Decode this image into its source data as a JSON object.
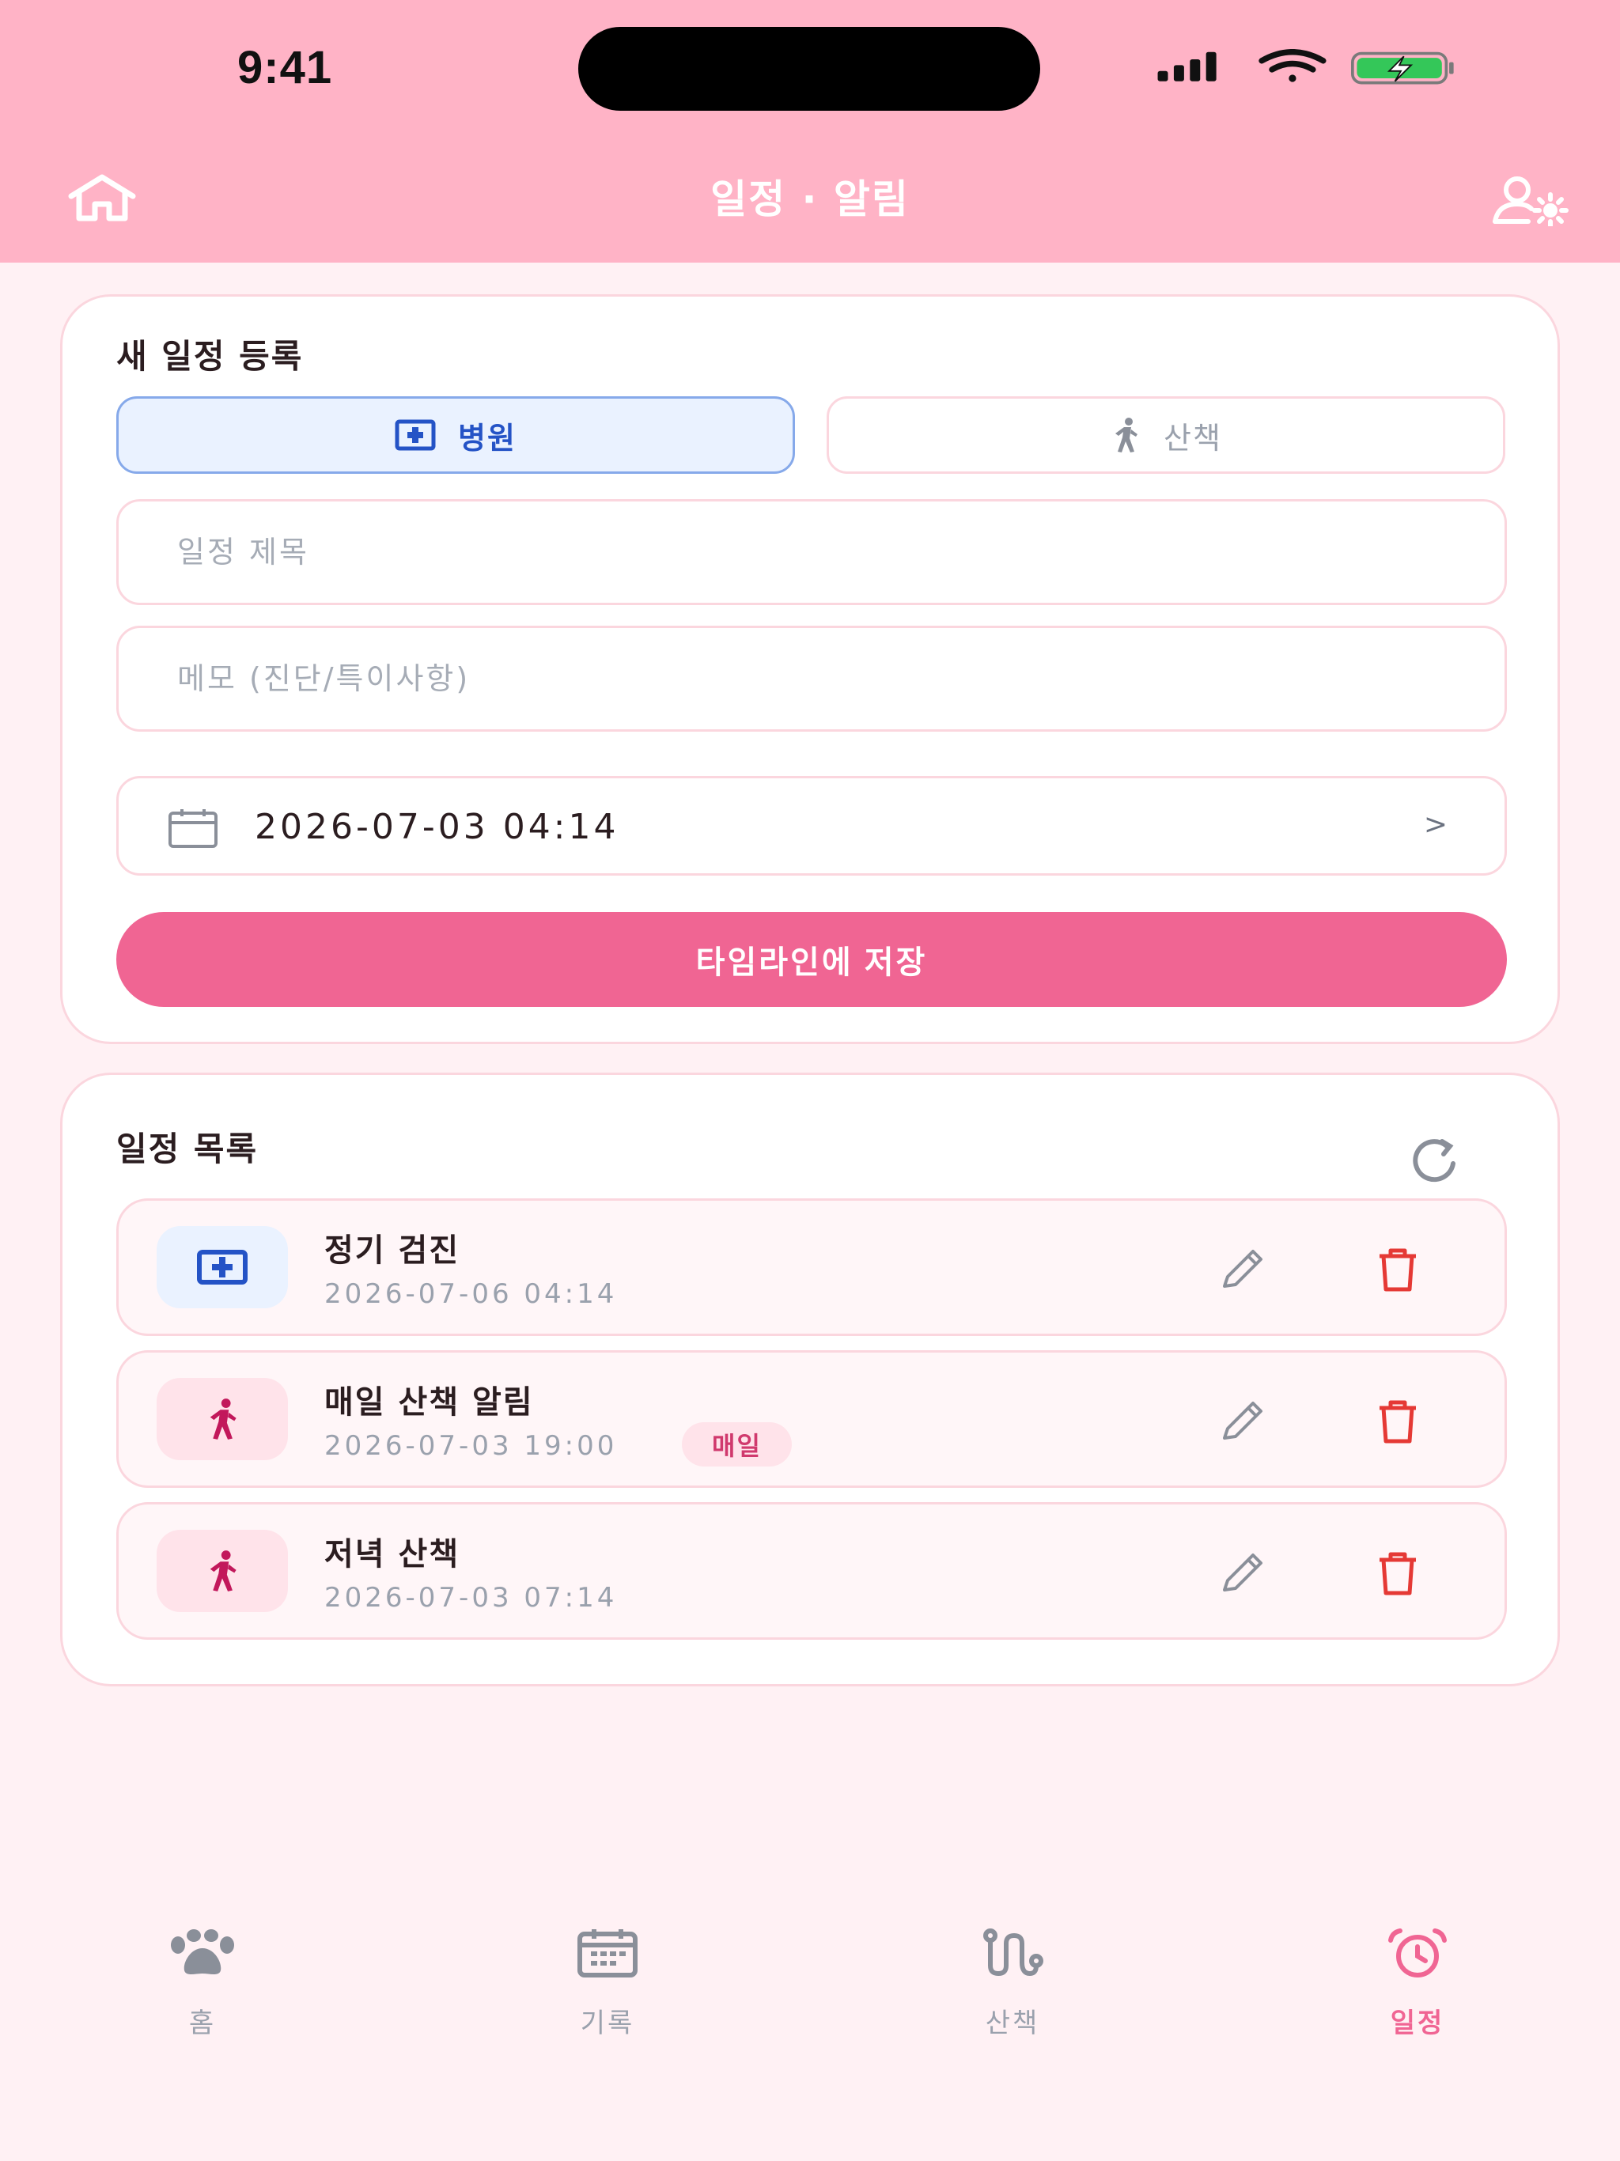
{
  "status_bar": {
    "time": "9:41"
  },
  "header": {
    "title": "일정 · 알림"
  },
  "new_schedule": {
    "title": "새 일정 등록",
    "types": [
      {
        "label": "병원",
        "icon": "hospital-icon",
        "selected": true
      },
      {
        "label": "산책",
        "icon": "walk-icon",
        "selected": false
      }
    ],
    "title_placeholder": "일정 제목",
    "memo_placeholder": "메모 (진단/특이사항)",
    "datetime": "2026-07-03 04:14",
    "chevron": ">",
    "save_label": "타임라인에 저장"
  },
  "schedule_list": {
    "title": "일정 목록",
    "items": [
      {
        "type": "hospital",
        "title": "정기 검진",
        "datetime": "2026-07-06 04:14",
        "badge": ""
      },
      {
        "type": "walk",
        "title": "매일 산책 알림",
        "datetime": "2026-07-03 19:00",
        "badge": "매일"
      },
      {
        "type": "walk",
        "title": "저녁 산책",
        "datetime": "2026-07-03 07:14",
        "badge": ""
      }
    ]
  },
  "tabs": [
    {
      "label": "홈",
      "icon": "paw-icon",
      "active": false
    },
    {
      "label": "기록",
      "icon": "calendar-icon",
      "active": false
    },
    {
      "label": "산책",
      "icon": "route-icon",
      "active": false
    },
    {
      "label": "일정",
      "icon": "alarm-clock-icon",
      "active": true
    }
  ],
  "colors": {
    "header_bg": "#ffb3c6",
    "accent": "#f06593",
    "hospital_blue": "#2453c6",
    "walk_red": "#c2185b",
    "delete_red": "#e53935"
  }
}
